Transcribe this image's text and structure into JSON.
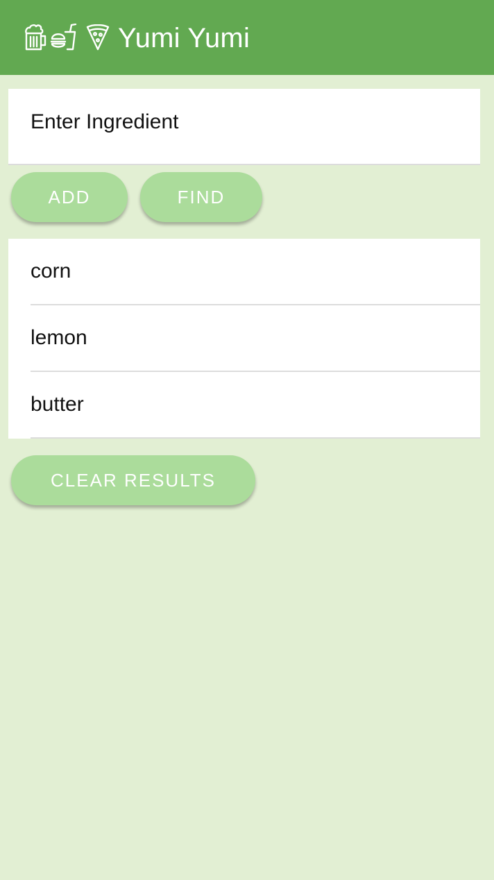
{
  "header": {
    "title": "Yumi Yumi",
    "icons": [
      "beer-mug-icon",
      "burger-drink-icon",
      "pizza-slice-icon"
    ],
    "background_color": "#62a951"
  },
  "search": {
    "placeholder": "Enter Ingredient",
    "value": ""
  },
  "actions": {
    "add_label": "ADD",
    "find_label": "FIND",
    "clear_label": "CLEAR RESULTS",
    "button_color": "#abdc9b"
  },
  "ingredients": [
    {
      "label": "corn"
    },
    {
      "label": "lemon"
    },
    {
      "label": "butter"
    }
  ],
  "page": {
    "background_color": "#e2efd3"
  }
}
